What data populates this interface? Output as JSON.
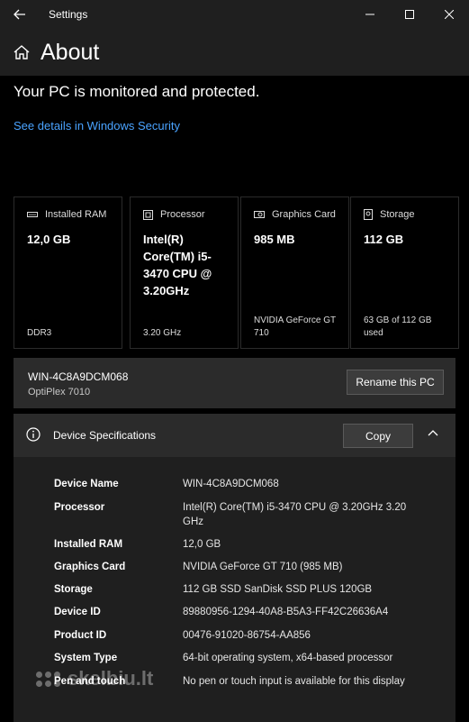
{
  "window": {
    "title": "Settings"
  },
  "page": {
    "title": "About"
  },
  "status": {
    "text": "Your PC is monitored and protected.",
    "link": "See details in Windows Security"
  },
  "cards": [
    {
      "label": "Installed RAM",
      "value": "12,0 GB",
      "footer": "DDR3",
      "icon": "ram-icon"
    },
    {
      "label": "Processor",
      "value": "Intel(R) Core(TM) i5-3470 CPU @ 3.20GHz",
      "footer": "3.20 GHz",
      "icon": "processor-icon"
    },
    {
      "label": "Graphics Card",
      "value": "985 MB",
      "footer": "NVIDIA GeForce GT 710",
      "icon": "graphics-card-icon"
    },
    {
      "label": "Storage",
      "value": "112 GB",
      "footer": "63 GB of 112 GB used",
      "icon": "storage-icon"
    }
  ],
  "pc": {
    "name": "WIN-4C8A9DCM068",
    "model": "OptiPlex 7010",
    "rename_label": "Rename this PC"
  },
  "specs": {
    "title": "Device Specifications",
    "copy_label": "Copy",
    "rows": [
      {
        "key": "Device Name",
        "value": "WIN-4C8A9DCM068"
      },
      {
        "key": "Processor",
        "value": "Intel(R) Core(TM) i5-3470 CPU @ 3.20GHz   3.20 GHz"
      },
      {
        "key": "Installed RAM",
        "value": "12,0 GB"
      },
      {
        "key": "Graphics Card",
        "value": "NVIDIA GeForce GT 710 (985 MB)"
      },
      {
        "key": "Storage",
        "value": "112 GB SSD SanDisk SSD PLUS 120GB"
      },
      {
        "key": "Device ID",
        "value": "89880956-1294-40A8-B5A3-FF42C26636A4"
      },
      {
        "key": "Product ID",
        "value": "00476-91020-86754-AA856"
      },
      {
        "key": "System Type",
        "value": "64-bit operating system, x64-based processor"
      },
      {
        "key": "Pen and touch",
        "value": "No pen or touch input is available for this display"
      }
    ]
  },
  "watermark": {
    "text": "skelbiu.lt"
  },
  "colors": {
    "background": "#000000",
    "panel": "#2b2b2b",
    "link": "#4aa3ff"
  }
}
